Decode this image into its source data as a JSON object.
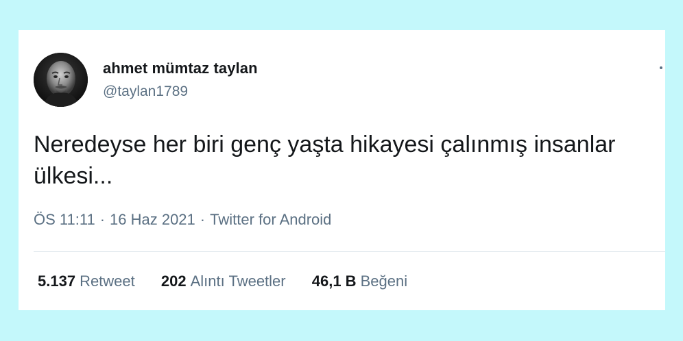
{
  "tweet": {
    "author": {
      "name": "ahmet mümtaz taylan",
      "handle": "@taylan1789"
    },
    "text": "Neredeyse her biri genç yaşta hikayesi çalınmış insanlar ülkesi...",
    "time": "ÖS 11:11",
    "date": "16 Haz 2021",
    "source": "Twitter for Android",
    "separator": "·",
    "stats": [
      {
        "value": "5.137",
        "label": "Retweet"
      },
      {
        "value": "202",
        "label": "Alıntı Tweetler"
      },
      {
        "value": "46,1 B",
        "label": "Beğeni"
      }
    ]
  },
  "colors": {
    "background": "#c4f8fb",
    "card": "#ffffff",
    "text_primary": "#14171a",
    "text_secondary": "#5b7083"
  },
  "icons": {
    "more": "more-dot-icon"
  }
}
